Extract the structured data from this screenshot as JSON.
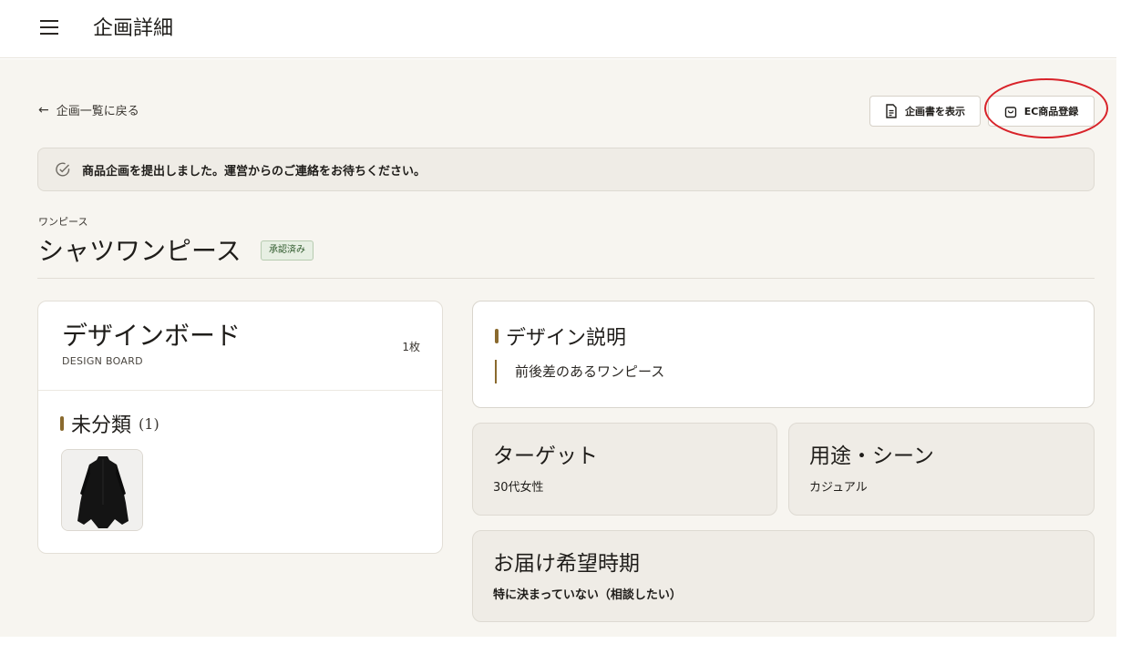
{
  "header": {
    "page_title": "企画詳細"
  },
  "nav": {
    "back_label": "企画一覧に戻る"
  },
  "actions": {
    "view_doc_label": "企画書を表示",
    "ec_register_label": "EC商品登録"
  },
  "notice": {
    "message": "商品企画を提出しました。運営からのご連絡をお待ちください。"
  },
  "product": {
    "category": "ワンピース",
    "title": "シャツワンピース",
    "status": "承認済み"
  },
  "design_board": {
    "title": "デザインボード",
    "subtitle": "DESIGN BOARD",
    "count": "1枚",
    "group_title": "未分類",
    "group_count": "(1)"
  },
  "design_description": {
    "title": "デザイン説明",
    "text": "前後差のあるワンピース"
  },
  "target": {
    "title": "ターゲット",
    "value": "30代女性"
  },
  "usage": {
    "title": "用途・シーン",
    "value": "カジュアル"
  },
  "delivery": {
    "title": "お届け希望時期",
    "value": "特に決まっていない（相談したい）"
  },
  "icons": [
    "menu-icon",
    "arrow-left-icon",
    "document-icon",
    "shopping-bag-icon",
    "check-circle-icon"
  ],
  "colors": {
    "background": "#f7f5f0",
    "accent": "#8a6a2e",
    "badge_bg": "#e7efe3",
    "badge_text": "#2f5a2c",
    "annotation": "#d8232a"
  }
}
